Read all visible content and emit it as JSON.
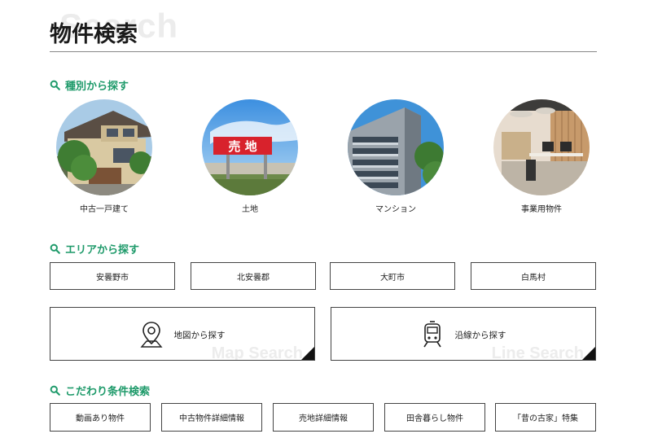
{
  "header": {
    "title": "物件検索",
    "bg_text": "Search"
  },
  "sections": {
    "type": {
      "heading": "種別から探す"
    },
    "area": {
      "heading": "エリアから探す"
    },
    "condition": {
      "heading": "こだわり条件検索"
    }
  },
  "types": [
    {
      "label": "中古一戸建て",
      "image": "house-photo"
    },
    {
      "label": "土地",
      "image": "land-sign-photo",
      "sign_text": "売 地"
    },
    {
      "label": "マンション",
      "image": "apartment-photo"
    },
    {
      "label": "事業用物件",
      "image": "office-photo"
    }
  ],
  "areas": [
    "安曇野市",
    "北安曇郡",
    "大町市",
    "白馬村"
  ],
  "search_modes": {
    "map": {
      "label": "地図から探す",
      "bg_text": "Map Search",
      "icon": "map-pin-icon"
    },
    "line": {
      "label": "沿線から探す",
      "bg_text": "Line Search",
      "icon": "train-icon"
    }
  },
  "conditions": [
    "動画あり物件",
    "中古物件詳細情報",
    "売地詳細情報",
    "田舎暮らし物件",
    "「昔の古家」特集"
  ],
  "colors": {
    "accent": "#1e9a6a",
    "border": "#444444",
    "text": "#222222"
  }
}
